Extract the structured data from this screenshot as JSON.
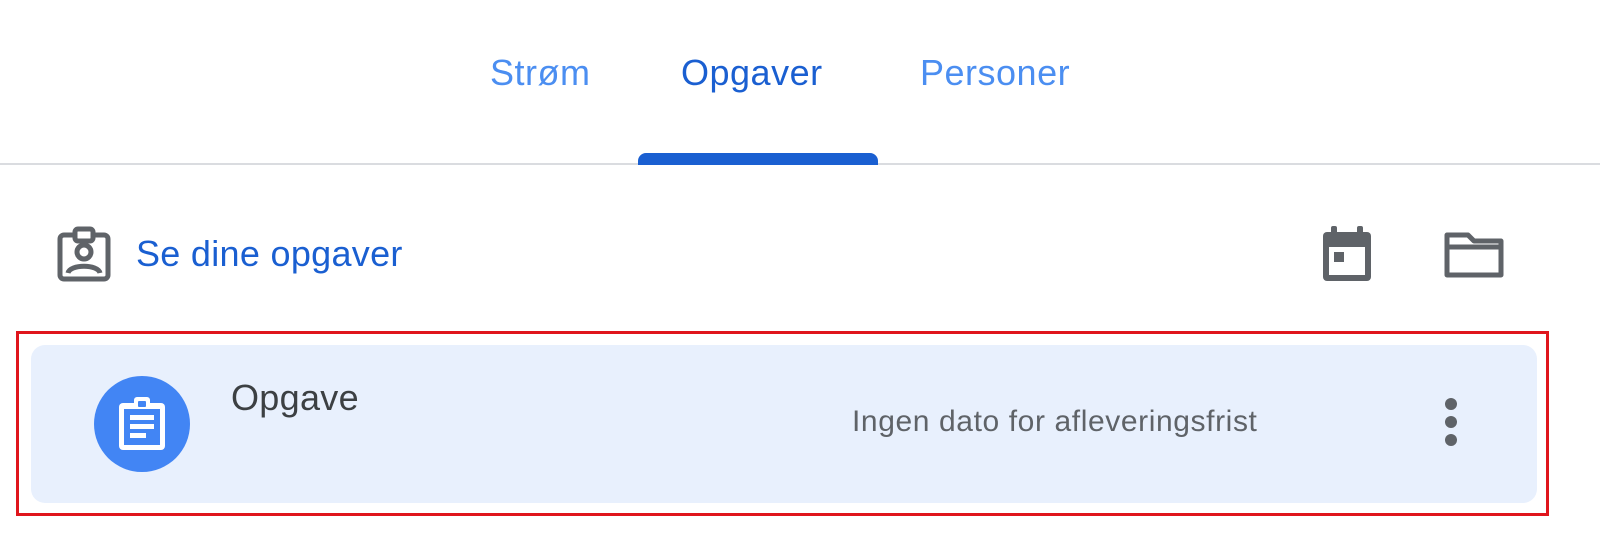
{
  "tabs": [
    {
      "label": "Strøm",
      "active": false
    },
    {
      "label": "Opgaver",
      "active": true
    },
    {
      "label": "Personer",
      "active": false
    }
  ],
  "toolbar": {
    "your_work_label": "Se dine opgaver",
    "your_work_icon": "assignment-ind-icon",
    "calendar_icon": "calendar-icon",
    "folder_icon": "folder-icon"
  },
  "assignment": {
    "title": "Opgave",
    "due": "Ingen dato for afleveringsfrist",
    "icon": "assignment-icon",
    "menu_icon": "more-vert-icon"
  },
  "colors": {
    "accent": "#1a5fd1",
    "tab_inactive": "#4b8ef1",
    "card_bg": "#e8f0fd",
    "avatar": "#4285f4",
    "highlight": "#e0161d",
    "icon_gray": "#5f6368"
  }
}
